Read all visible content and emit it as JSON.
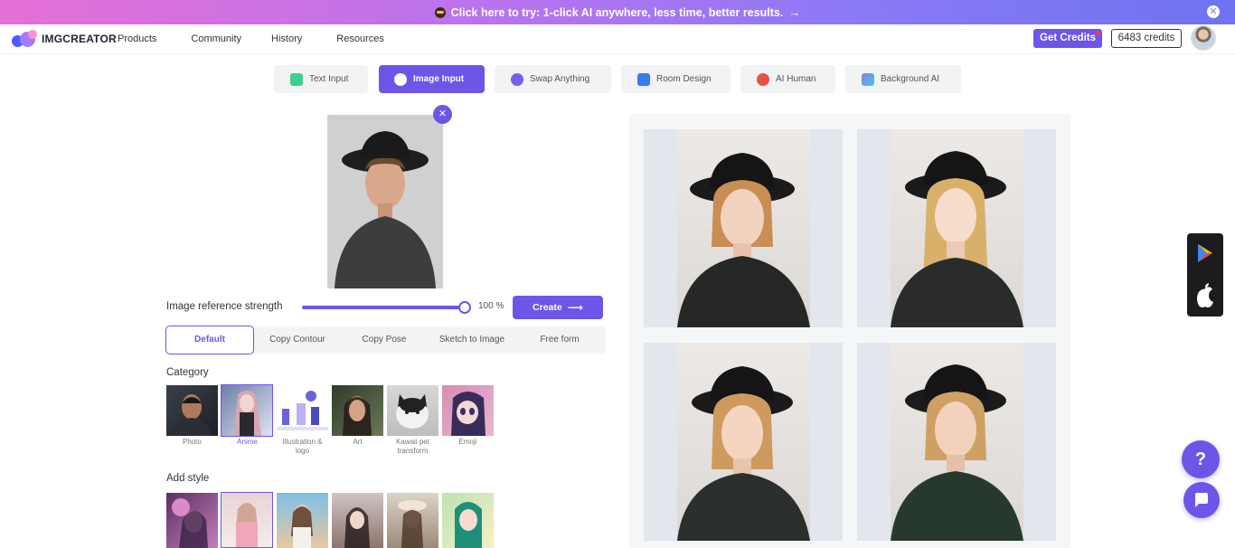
{
  "banner": {
    "text": "Click here to try: 1-click AI anywhere, less time, better results.",
    "arrow": "→",
    "close": "✕"
  },
  "nav": {
    "logo": "IMGCREATOR",
    "menu": [
      "Products",
      "Community",
      "History",
      "Resources"
    ],
    "get_credits": "Get Credits",
    "credits": "6483 credits"
  },
  "tabs": [
    {
      "label": "Text Input",
      "icon": "text-icon",
      "color": "#3ecf8e"
    },
    {
      "label": "Image Input",
      "icon": "image-icon",
      "color": "#ffffff"
    },
    {
      "label": "Swap Anything",
      "icon": "swap-icon",
      "color": "#7b5cf0"
    },
    {
      "label": "Room Design",
      "icon": "house-icon",
      "color": "#2f7ff0"
    },
    {
      "label": "AI Human",
      "icon": "human-icon",
      "color": "#e8523f"
    },
    {
      "label": "Background AI",
      "icon": "landscape-icon",
      "color": "#8a79f5"
    }
  ],
  "image_input": {
    "remove": "✕",
    "strength_label": "Image reference strength",
    "strength_value": "100 %",
    "strength_fraction": 1.0,
    "create_label": "Create",
    "create_arrow": "⟶"
  },
  "modes": [
    "Default",
    "Copy Contour",
    "Copy Pose",
    "Sketch to Image",
    "Free form"
  ],
  "category": {
    "title": "Category",
    "items": [
      "Photo",
      "Anime",
      "Illustration & logo",
      "Art",
      "Kawaii pet transform",
      "Emoji"
    ]
  },
  "style": {
    "title": "Add style"
  },
  "colors": {
    "accent": "#6e55e8",
    "panel": "#f2f3f5"
  }
}
